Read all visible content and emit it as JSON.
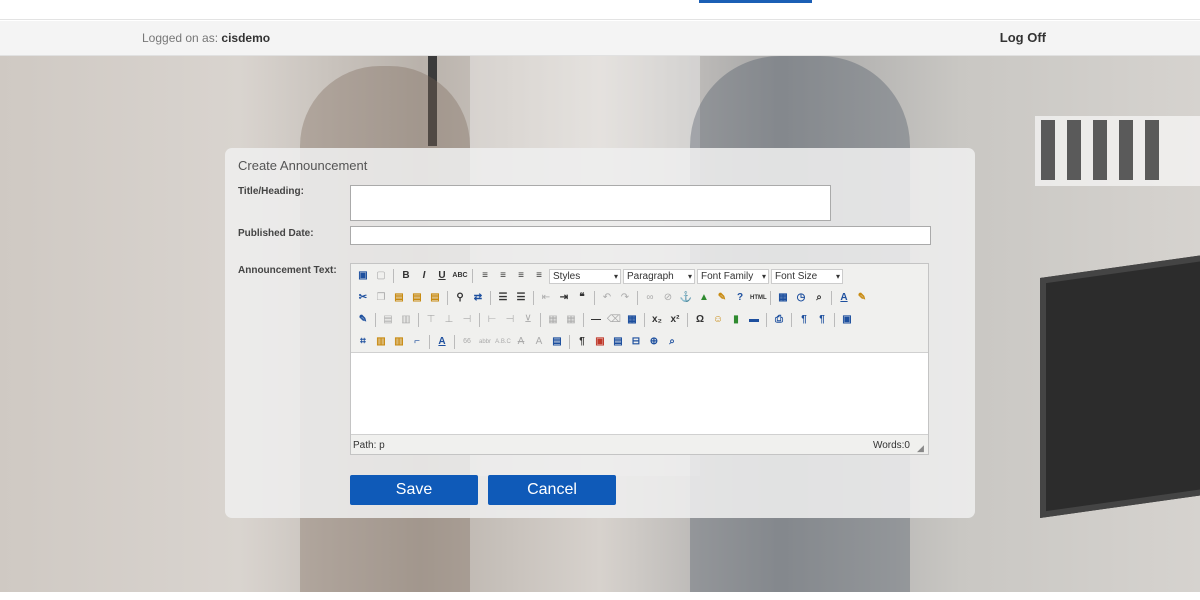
{
  "header": {
    "logged_on_prefix": "Logged on as:",
    "username": "cisdemo",
    "log_off_label": "Log Off"
  },
  "form": {
    "title": "Create Announcement",
    "labels": {
      "title_heading": "Title/Heading:",
      "published_date": "Published Date:",
      "announcement_text": "Announcement Text:"
    },
    "values": {
      "title_heading": "",
      "published_date": ""
    }
  },
  "editor": {
    "dropdowns": {
      "styles": "Styles",
      "paragraph": "Paragraph",
      "font_family": "Font Family",
      "font_size": "Font Size"
    },
    "status": {
      "path": "Path: p",
      "words": "Words:0"
    }
  },
  "buttons": {
    "save": "Save",
    "cancel": "Cancel"
  },
  "colors": {
    "accent": "#0f5ab8",
    "top_accent": "#1b5fb5"
  }
}
